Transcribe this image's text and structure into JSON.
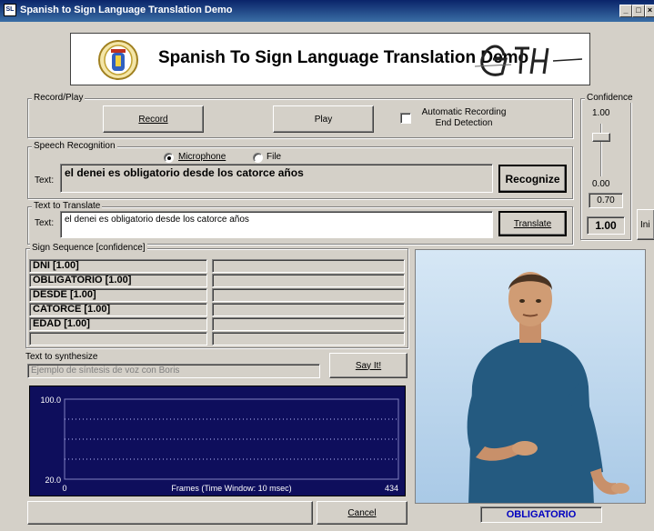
{
  "window": {
    "title": "Spanish to Sign Language Translation Demo"
  },
  "banner": {
    "title": "Spanish To Sign Language Translation Demo",
    "logo_text": "GTH"
  },
  "record_play": {
    "label": "Record/Play",
    "record_button": "Record",
    "play_button": "Play",
    "auto_detect_label": "Automatic Recording End Detection",
    "auto_detect_checked": false
  },
  "confidence": {
    "label": "Confidence",
    "max": "1.00",
    "min": "0.00",
    "threshold": "0.70",
    "value": "1.00"
  },
  "speech_recognition": {
    "label": "Speech Recognition",
    "source_options": [
      "Microphone",
      "File"
    ],
    "selected_source": "Microphone",
    "text_label": "Text:",
    "text_value": "el denei es obligatorio desde los catorce años",
    "recognize_button": "Recognize"
  },
  "text_to_translate": {
    "label": "Text to Translate",
    "text_label": "Text:",
    "text_value": "el denei es obligatorio desde los catorce años",
    "translate_button": "Translate"
  },
  "ini_button": "Ini",
  "sign_sequence": {
    "label": "Sign Sequence [confidence]",
    "items": [
      "DNI [1.00]",
      "OBLIGATORIO [1.00]",
      "DESDE [1.00]",
      "CATORCE [1.00]",
      "EDAD [1.00]",
      ""
    ]
  },
  "synthesize": {
    "label": "Text to synthesize",
    "placeholder": "Ejemplo de síntesis de voz con Boris",
    "say_button": "Say It!"
  },
  "chart_data": {
    "type": "line",
    "xlabel": "Frames (Time Window: 10 msec)",
    "xlim": [
      0,
      434
    ],
    "ylim": [
      20.0,
      100.0
    ],
    "x_ticks": [
      "0",
      "434"
    ],
    "y_ticks": [
      "100.0",
      "20.0"
    ],
    "series": [],
    "grid": true
  },
  "cancel_button": "Cancel",
  "avatar": {
    "current_sign": "OBLIGATORIO"
  },
  "colors": {
    "titlebar": "#0a246a",
    "plot_bg": "#0e0e5c",
    "avatar_bg": "#c8dff0",
    "sign_label": "#0000c0"
  }
}
